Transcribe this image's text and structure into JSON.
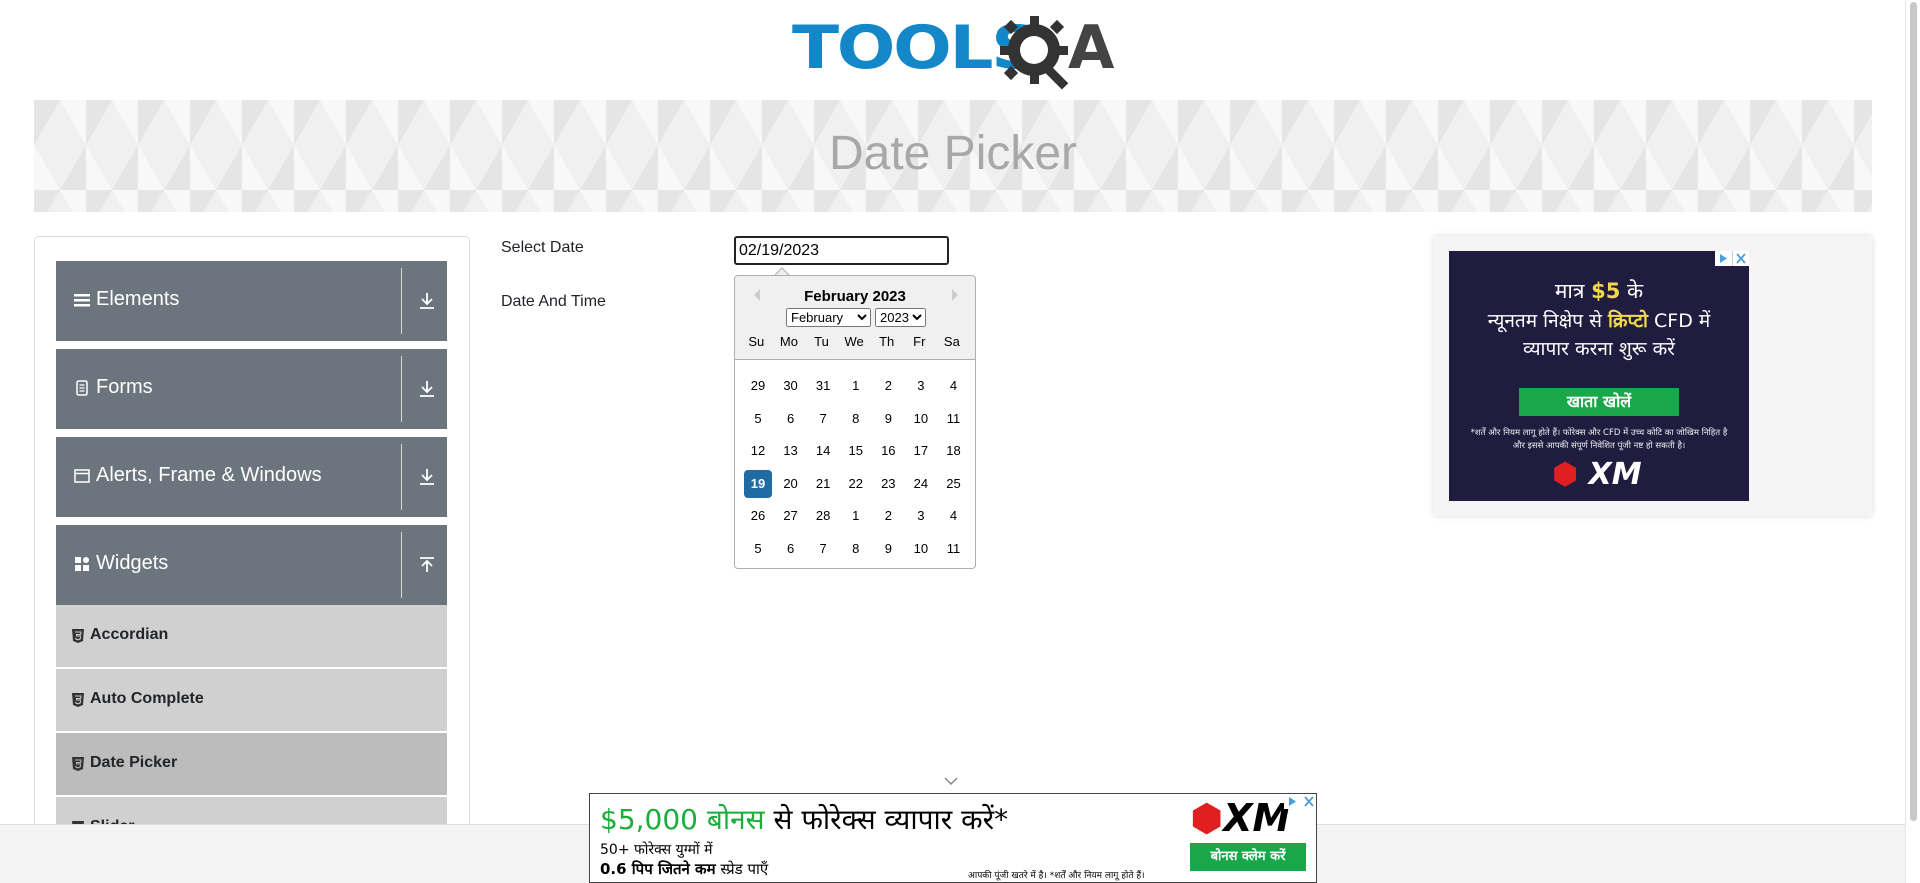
{
  "header": {
    "logo_text": "TOOLS",
    "logo_letter": "A",
    "logo_alt": "TOOLSQA"
  },
  "banner": {
    "title": "Date Picker"
  },
  "sidebar": {
    "groups": [
      {
        "label": "Elements",
        "icon": "hamburger-icon"
      },
      {
        "label": "Forms",
        "icon": "document-icon"
      },
      {
        "label": "Alerts, Frame & Windows",
        "icon": "window-icon"
      },
      {
        "label": "Widgets",
        "icon": "widgets-grid-icon"
      }
    ],
    "items": [
      {
        "label": "Accordian"
      },
      {
        "label": "Auto Complete"
      },
      {
        "label": "Date Picker",
        "active": true
      },
      {
        "label": "Slider"
      }
    ]
  },
  "form": {
    "select_date_label": "Select Date",
    "select_date_value": "02/19/2023",
    "date_time_label": "Date And Time"
  },
  "calendar": {
    "month_title": "February 2023",
    "month_select": "February",
    "year_select": "2023",
    "weekdays": [
      "Su",
      "Mo",
      "Tu",
      "We",
      "Th",
      "Fr",
      "Sa"
    ],
    "weeks": [
      [
        "29",
        "30",
        "31",
        "1",
        "2",
        "3",
        "4"
      ],
      [
        "5",
        "6",
        "7",
        "8",
        "9",
        "10",
        "11"
      ],
      [
        "12",
        "13",
        "14",
        "15",
        "16",
        "17",
        "18"
      ],
      [
        "19",
        "20",
        "21",
        "22",
        "23",
        "24",
        "25"
      ],
      [
        "26",
        "27",
        "28",
        "1",
        "2",
        "3",
        "4"
      ],
      [
        "5",
        "6",
        "7",
        "8",
        "9",
        "10",
        "11"
      ]
    ],
    "selected_day": "19",
    "selected_color": "#216ba5"
  },
  "ad_right": {
    "line1_pre": "मात्र ",
    "line1_hl": "$5",
    "line1_post": " के",
    "line2_pre": "न्यूनतम निक्षेप से ",
    "line2_hl": "क्रिप्टो",
    "line2_post": " CFD में",
    "line3": "व्यापार करना शुरू करें",
    "button": "खाता खोलें",
    "disclaimer": "*शर्तें और नियम लागू होते हैं। फोरेक्स और CFD में उच्च कोटि का जोखिम निहित है और इससे आपकी संपूर्ण निवेशित पूंजी नष्ट हो सकती है।",
    "brand": "XM"
  },
  "ad_bottom": {
    "head_green": "$5,000 बोनस",
    "head_rest": " से फोरेक्स व्यापार करें*",
    "line2": "50+ फोरेक्स युग्मों में",
    "line3_bold": "0.6 पिप जितने कम",
    "line3_rest": " स्प्रेड पाएँ",
    "risk": "आपकी पूंजी खतरे में है। *शर्तें और नियम लागू होते हैं।",
    "button": "बोनस क्लेम करें",
    "brand": "XM"
  }
}
